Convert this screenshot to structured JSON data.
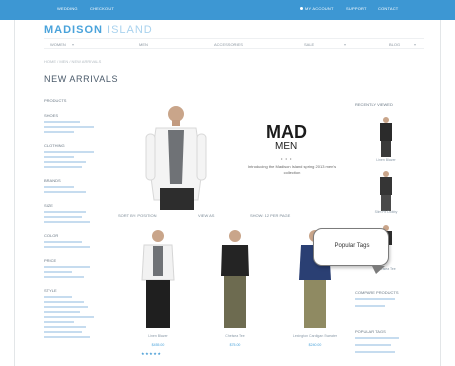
{
  "topbar": {
    "left": [
      "WEDDING",
      "CHECKOUT"
    ],
    "right": [
      "MY ACCOUNT",
      "SUPPORT",
      "CONTACT"
    ]
  },
  "logo": {
    "brand": "MADISON",
    "suffix": "ISLAND"
  },
  "filters": [
    "WOMEN",
    "MEN",
    "ACCESSORIES",
    "SALE",
    "BLOG"
  ],
  "breadcrumb": "HOME / MEN / NEW ARRIVALS",
  "page_title": "NEW ARRIVALS",
  "left_sidebar": {
    "groups": [
      {
        "heading": "PRODUCTS",
        "lines": 0
      },
      {
        "heading": "SHOES",
        "lines": 3
      },
      {
        "heading": "CLOTHING",
        "lines": 4
      },
      {
        "heading": "BRANDS",
        "lines": 2
      },
      {
        "heading": "SIZE",
        "lines": 3
      },
      {
        "heading": "COLOR",
        "lines": 2
      },
      {
        "heading": "PRICE",
        "lines": 3
      },
      {
        "heading": "STYLE",
        "lines": 9
      }
    ]
  },
  "hero": {
    "headline": "MAD",
    "subhead": "MEN",
    "dots": "• • •",
    "tagline": "Introducing the Madison Island spring 2013 men's collection"
  },
  "sortbar": [
    "SORT BY: POSITION",
    "VIEW AS",
    "SHOW: 12 PER PAGE"
  ],
  "right_sidebar": {
    "heading": "RECENTLY VIEWED",
    "captions": [
      "Linen Blazer",
      "Slim Fit Dobby",
      "Chelsea Tee"
    ],
    "section2": "COMPARE PRODUCTS",
    "section3": "POPULAR TAGS"
  },
  "products": [
    {
      "name": "Linen Blazer",
      "price": "$455.00"
    },
    {
      "name": "Chelsea Tee",
      "price": "$75.00"
    },
    {
      "name": "Lexington Cardigan Sweater",
      "price": "$240.00"
    }
  ],
  "stars": "★★★★★",
  "callout": {
    "text": "Popular Tags"
  },
  "colors": {
    "accent": "#3d97d3",
    "link": "#4aa3db"
  }
}
